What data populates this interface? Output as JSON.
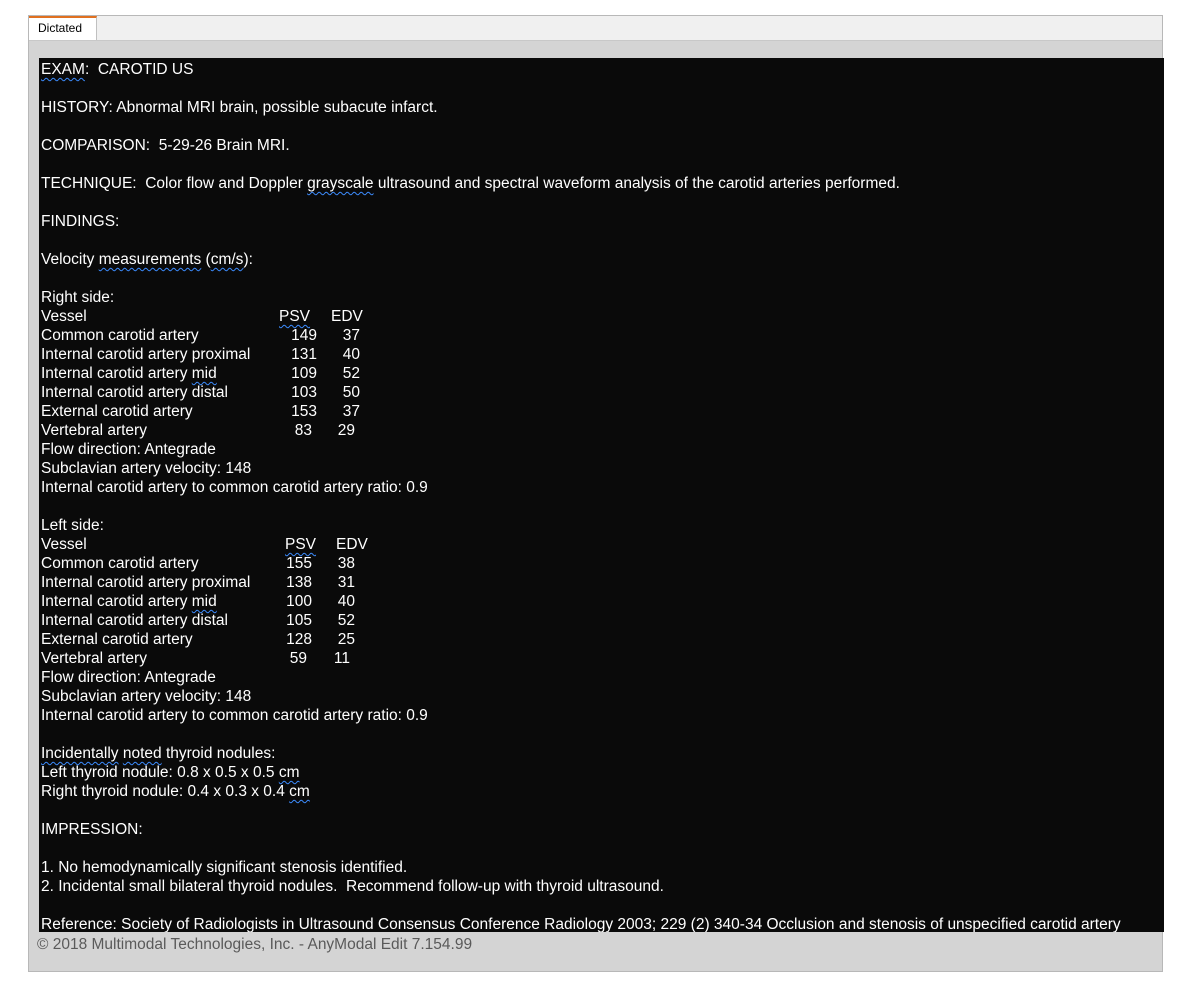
{
  "tab": {
    "label": "Dictated"
  },
  "report": {
    "exam_label": "EXAM",
    "exam_value": ":  CAROTID US",
    "history": "HISTORY: Abnormal MRI brain, possible subacute infarct.",
    "comparison": "COMPARISON:  5-29-26 Brain MRI.",
    "technique_pre": "TECHNIQUE:  Color flow and Doppler ",
    "technique_sq": "grayscale",
    "technique_post": " ultrasound and spectral waveform analysis of the carotid arteries performed.",
    "findings": "FINDINGS:",
    "velocity_pre": "Velocity ",
    "velocity_sq1": "measurements",
    "velocity_mid": " (",
    "velocity_sq2": "cm/s",
    "velocity_post": "):",
    "right_side": {
      "title": "Right side:",
      "vessel_header": "Vessel",
      "psv_header": "PSV",
      "edv_header": "EDV",
      "rows": [
        {
          "name": "Common carotid artery",
          "psv": "149",
          "edv": "37"
        },
        {
          "name": "Internal carotid artery proximal",
          "psv": "131",
          "edv": "40"
        },
        {
          "name_pre": "Internal carotid artery ",
          "name_sq": "mid",
          "psv": "109",
          "edv": "52"
        },
        {
          "name": "Internal carotid artery distal",
          "psv": "103",
          "edv": "50"
        },
        {
          "name": "External carotid artery",
          "psv": "153",
          "edv": "37"
        },
        {
          "name": "Vertebral artery",
          "psv": "83",
          "edv": "29"
        }
      ],
      "flow": "Flow direction: Antegrade",
      "subclavian": "Subclavian artery velocity: 148",
      "ratio": "Internal carotid artery to common carotid artery ratio: 0.9"
    },
    "left_side": {
      "title": "Left side:",
      "vessel_header": "Vessel",
      "psv_header": "PSV",
      "edv_header": "EDV",
      "rows": [
        {
          "name": "Common carotid artery",
          "psv": "155",
          "edv": "38"
        },
        {
          "name": "Internal carotid artery proximal",
          "psv": "138",
          "edv": "31"
        },
        {
          "name_pre": "Internal carotid artery ",
          "name_sq": "mid",
          "psv": "100",
          "edv": "40"
        },
        {
          "name": "Internal carotid artery distal",
          "psv": "105",
          "edv": "52"
        },
        {
          "name": "External carotid artery",
          "psv": "128",
          "edv": "25"
        },
        {
          "name": "Vertebral artery",
          "psv": "59",
          "edv": "11"
        }
      ],
      "flow": "Flow direction: Antegrade",
      "subclavian": "Subclavian artery velocity: 148",
      "ratio": "Internal carotid artery to common carotid artery ratio: 0.9"
    },
    "thyroid_sq1": "Incidentally",
    "thyroid_sp": " ",
    "thyroid_sq2": "noted",
    "thyroid_post": " thyroid nodules:",
    "left_nodule_pre": "Left thyroid nodule: 0.8 x 0.5 x 0.5 ",
    "left_nodule_sq": "cm",
    "right_nodule_pre": "Right thyroid nodule: 0.4 x 0.3 x 0.4 ",
    "right_nodule_sq": "cm",
    "impression": "IMPRESSION:",
    "impression_1": "1. No hemodynamically significant stenosis identified.",
    "impression_2": "2. Incidental small bilateral thyroid nodules.  Recommend follow-up with thyroid ultrasound.",
    "ref_1": "Reference: Society of ",
    "ref_sq1": "Radiologists",
    "ref_2": " in Ultrasound Consensus ",
    "ref_sq2": "Conference",
    "ref_3": " Radiology 2003; 229 (2) 340-34 Occlusion and stenosis of ",
    "ref_sq3": "unspecified",
    "ref_4": " carotid artery"
  },
  "footer": {
    "copyright": "© 2018 Multimodal Technologies, Inc. - AnyModal Edit 7.154.99"
  }
}
